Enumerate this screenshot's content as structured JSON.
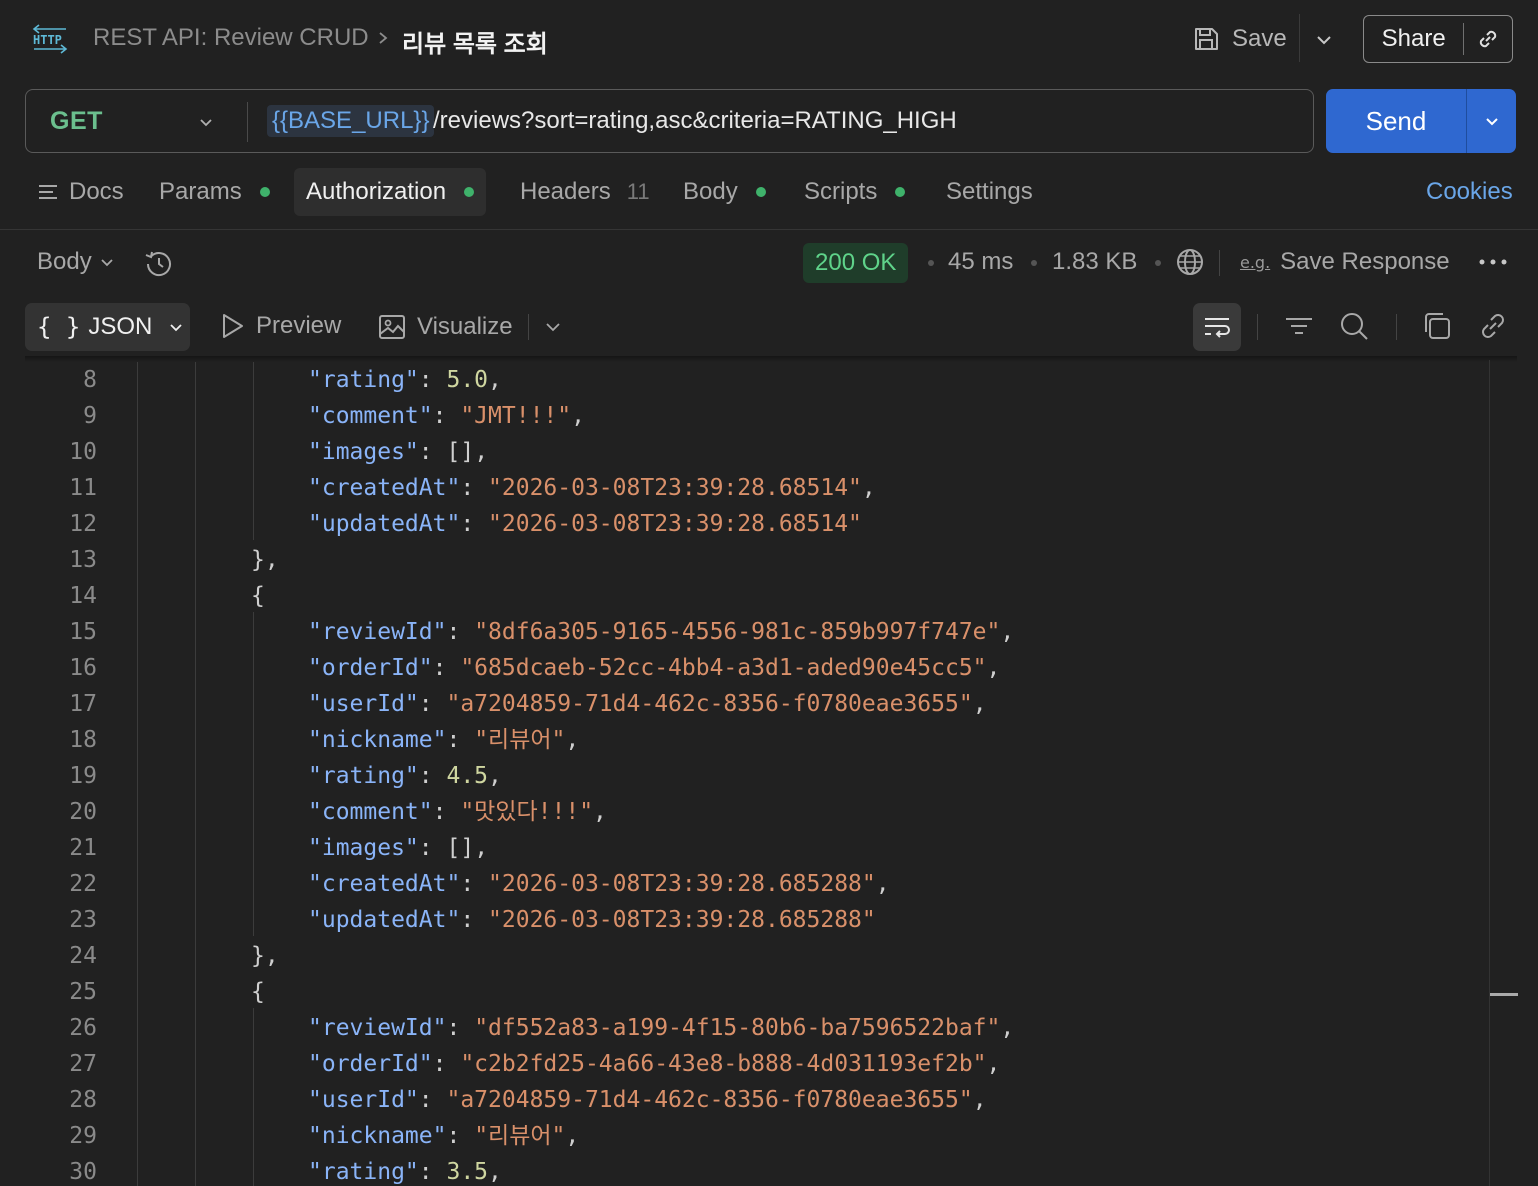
{
  "header": {
    "collection": "REST API: Review CRUD",
    "request_name": "리뷰 목록 조회",
    "save_label": "Save",
    "share_label": "Share"
  },
  "request": {
    "method": "GET",
    "url_variable": "{{BASE_URL}}",
    "url_path": "/reviews?sort=rating,asc&criteria=RATING_HIGH",
    "send_label": "Send"
  },
  "tabs": {
    "docs": "Docs",
    "params": "Params",
    "authorization": "Authorization",
    "headers": "Headers",
    "headers_count": "11",
    "body": "Body",
    "scripts": "Scripts",
    "settings": "Settings",
    "cookies": "Cookies"
  },
  "response": {
    "body_label": "Body",
    "status": "200 OK",
    "time": "45 ms",
    "size": "1.83 KB",
    "save_response": "Save Response",
    "format": "JSON",
    "preview": "Preview",
    "visualize": "Visualize"
  },
  "code_lines": [
    {
      "n": "8",
      "indent": 2,
      "key": "rating",
      "value": "5.0",
      "type": "num",
      "comma": true
    },
    {
      "n": "9",
      "indent": 2,
      "key": "comment",
      "value": "JMT!!!",
      "type": "str",
      "comma": true
    },
    {
      "n": "10",
      "indent": 2,
      "key": "images",
      "value": "[]",
      "type": "raw",
      "comma": true
    },
    {
      "n": "11",
      "indent": 2,
      "key": "createdAt",
      "value": "2026-03-08T23:39:28.68514",
      "type": "str",
      "comma": true
    },
    {
      "n": "12",
      "indent": 2,
      "key": "updatedAt",
      "value": "2026-03-08T23:39:28.68514",
      "type": "str",
      "comma": false
    },
    {
      "n": "13",
      "indent": 1,
      "text": "},"
    },
    {
      "n": "14",
      "indent": 1,
      "text": "{"
    },
    {
      "n": "15",
      "indent": 2,
      "key": "reviewId",
      "value": "8df6a305-9165-4556-981c-859b997f747e",
      "type": "str",
      "comma": true
    },
    {
      "n": "16",
      "indent": 2,
      "key": "orderId",
      "value": "685dcaeb-52cc-4bb4-a3d1-aded90e45cc5",
      "type": "str",
      "comma": true
    },
    {
      "n": "17",
      "indent": 2,
      "key": "userId",
      "value": "a7204859-71d4-462c-8356-f0780eae3655",
      "type": "str",
      "comma": true
    },
    {
      "n": "18",
      "indent": 2,
      "key": "nickname",
      "value": "리뷰어",
      "type": "str",
      "comma": true
    },
    {
      "n": "19",
      "indent": 2,
      "key": "rating",
      "value": "4.5",
      "type": "num",
      "comma": true
    },
    {
      "n": "20",
      "indent": 2,
      "key": "comment",
      "value": "맛있다!!!",
      "type": "str",
      "comma": true
    },
    {
      "n": "21",
      "indent": 2,
      "key": "images",
      "value": "[]",
      "type": "raw",
      "comma": true
    },
    {
      "n": "22",
      "indent": 2,
      "key": "createdAt",
      "value": "2026-03-08T23:39:28.685288",
      "type": "str",
      "comma": true
    },
    {
      "n": "23",
      "indent": 2,
      "key": "updatedAt",
      "value": "2026-03-08T23:39:28.685288",
      "type": "str",
      "comma": false
    },
    {
      "n": "24",
      "indent": 1,
      "text": "},"
    },
    {
      "n": "25",
      "indent": 1,
      "text": "{"
    },
    {
      "n": "26",
      "indent": 2,
      "key": "reviewId",
      "value": "df552a83-a199-4f15-80b6-ba7596522baf",
      "type": "str",
      "comma": true
    },
    {
      "n": "27",
      "indent": 2,
      "key": "orderId",
      "value": "c2b2fd25-4a66-43e8-b888-4d031193ef2b",
      "type": "str",
      "comma": true
    },
    {
      "n": "28",
      "indent": 2,
      "key": "userId",
      "value": "a7204859-71d4-462c-8356-f0780eae3655",
      "type": "str",
      "comma": true
    },
    {
      "n": "29",
      "indent": 2,
      "key": "nickname",
      "value": "리뷰어",
      "type": "str",
      "comma": true
    },
    {
      "n": "30",
      "indent": 2,
      "key": "rating",
      "value": "3.5",
      "type": "num",
      "comma": true
    }
  ],
  "colors": {
    "accent": "#2f68d0",
    "method": "#6bbf8e",
    "status_ok": "#5fd38a",
    "link": "#6aa6e8"
  }
}
